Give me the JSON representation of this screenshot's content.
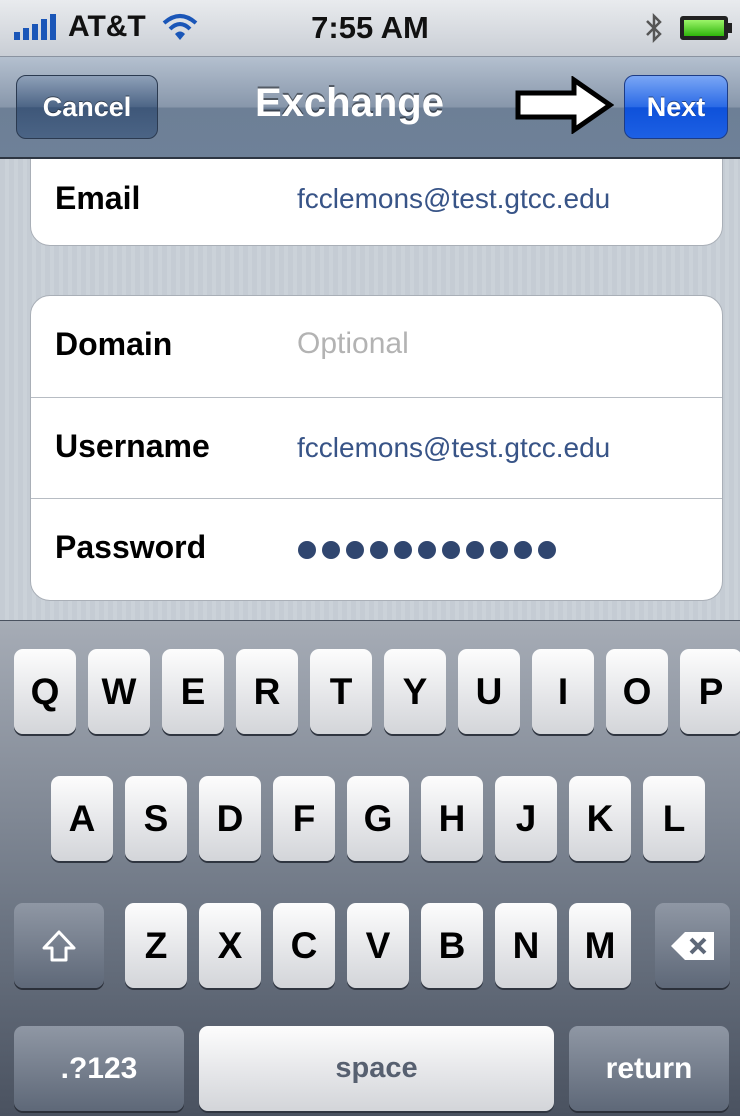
{
  "status_bar": {
    "carrier": "AT&T",
    "time": "7:55 AM",
    "icons": [
      "signal-icon",
      "wifi-icon",
      "bluetooth-icon",
      "battery-icon"
    ]
  },
  "nav": {
    "cancel_label": "Cancel",
    "title": "Exchange",
    "next_label": "Next"
  },
  "account": {
    "email_label": "Email",
    "email_value": "fcclemons@test.gtcc.edu"
  },
  "credentials": {
    "domain_label": "Domain",
    "domain_placeholder": "Optional",
    "username_label": "Username",
    "username_value": "fcclemons@test.gtcc.edu",
    "password_label": "Password",
    "password_mask": "●●●●●●●●●●●"
  },
  "keyboard": {
    "row1": [
      "Q",
      "W",
      "E",
      "R",
      "T",
      "Y",
      "U",
      "I",
      "O",
      "P"
    ],
    "row2": [
      "A",
      "S",
      "D",
      "F",
      "G",
      "H",
      "J",
      "K",
      "L"
    ],
    "row3": [
      "Z",
      "X",
      "C",
      "V",
      "B",
      "N",
      "M"
    ],
    "numbers_label": ".?123",
    "space_label": "space",
    "return_label": "return"
  },
  "colors": {
    "nav_bar": "#7a8aa0",
    "next_button": "#1d60e4",
    "value_text": "#385487",
    "keyboard_bg": "#6c7583"
  }
}
